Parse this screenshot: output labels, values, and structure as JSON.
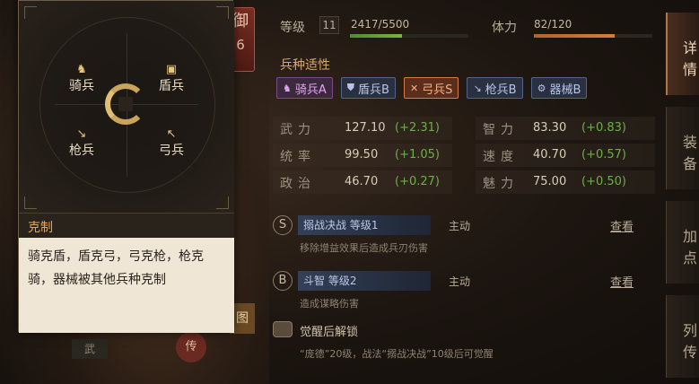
{
  "defense_badge": {
    "label": "御",
    "value": "6"
  },
  "top": {
    "level_label": "等级",
    "level": "11",
    "exp_text": "2417/5500",
    "exp_progress": 0.44,
    "stamina_label": "体力",
    "stamina_text": "82/120",
    "stamina_progress": 0.68
  },
  "troop_section_title": "兵种适性",
  "troops": [
    {
      "label": "骑兵A",
      "icon": "horse-icon"
    },
    {
      "label": "盾兵B",
      "icon": "shield-icon"
    },
    {
      "label": "弓兵S",
      "icon": "bow-icon"
    },
    {
      "label": "枪兵B",
      "icon": "spear-icon"
    },
    {
      "label": "器械B",
      "icon": "gear-icon"
    }
  ],
  "stats": [
    {
      "name": "武力",
      "value": "127.10",
      "bonus": "(+2.31)"
    },
    {
      "name": "智力",
      "value": "83.30",
      "bonus": "(+0.83)"
    },
    {
      "name": "统率",
      "value": "99.50",
      "bonus": "(+1.05)"
    },
    {
      "name": "速度",
      "value": "40.70",
      "bonus": "(+0.57)"
    },
    {
      "name": "政治",
      "value": "46.70",
      "bonus": "(+0.27)"
    },
    {
      "name": "魅力",
      "value": "75.00",
      "bonus": "(+0.50)"
    }
  ],
  "skills": [
    {
      "grade": "S",
      "name": "搦战决战 等级1",
      "type": "主动",
      "view": "查看",
      "desc": "移除增益效果后造成兵刃伤害"
    },
    {
      "grade": "B",
      "name": "斗智 等级2",
      "type": "主动",
      "view": "查看",
      "desc": "造成谋略伤害"
    }
  ],
  "awaken": {
    "title": "觉醒后解锁",
    "desc": "“庞德”20级，战法“搦战决战”10级后可觉醒"
  },
  "tabs": [
    "详情",
    "装备",
    "加点",
    "列传"
  ],
  "popup": {
    "units": {
      "cavalry": "骑兵",
      "shield": "盾兵",
      "spear": "枪兵",
      "bow": "弓兵"
    },
    "counter_title": "克制",
    "counter_desc": "骑克盾，盾克弓，弓克枪，枪克骑，器械被其他兵种克制"
  },
  "bottom": {
    "a": "武",
    "b": "传",
    "c": "图"
  }
}
